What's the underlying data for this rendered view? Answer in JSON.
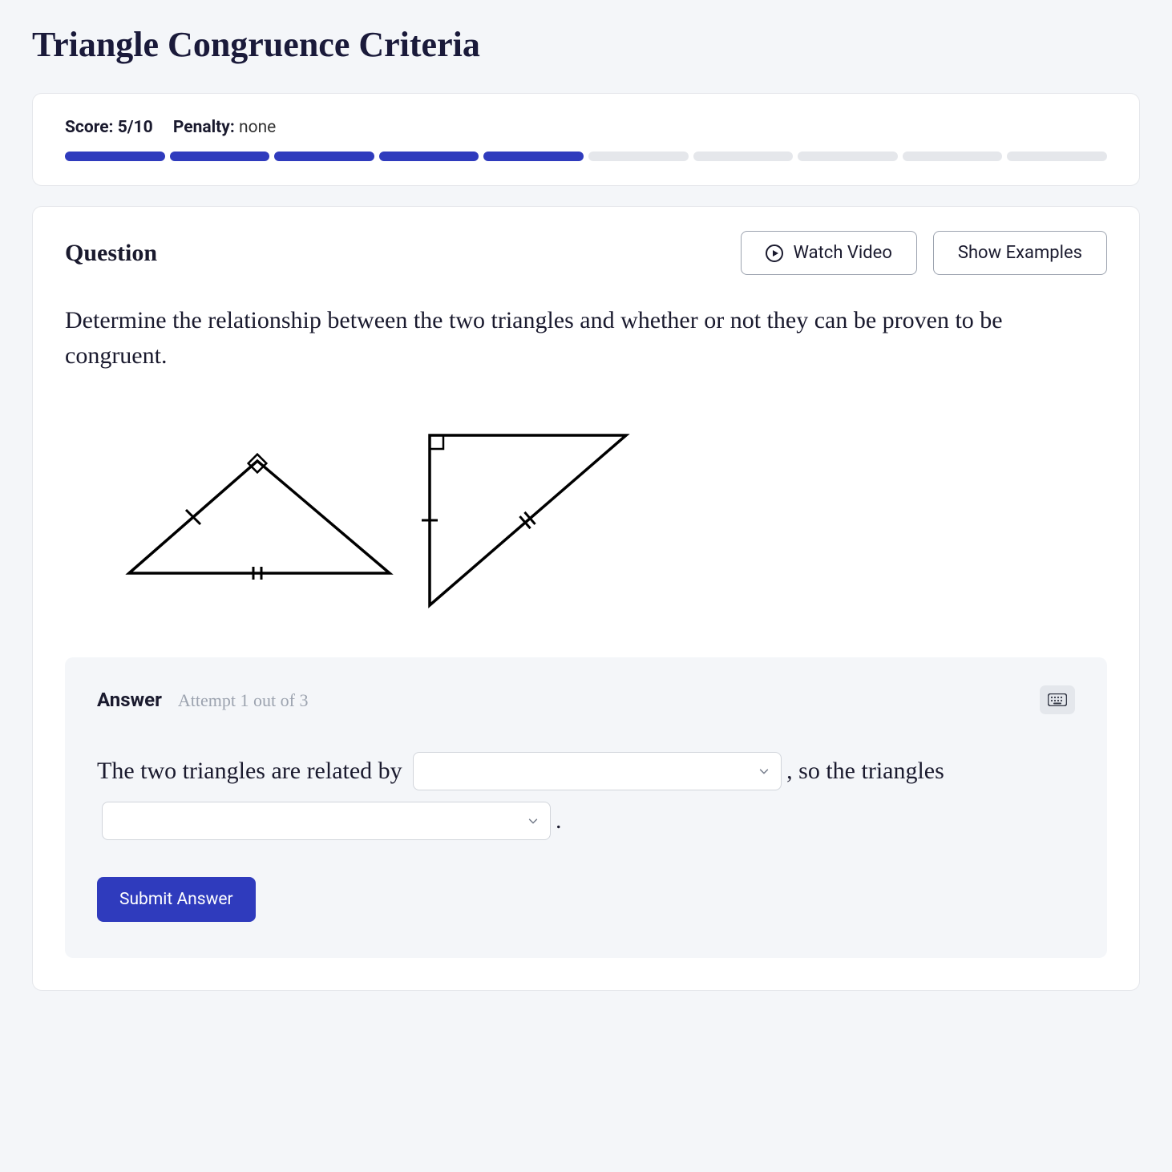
{
  "title": "Triangle Congruence Criteria",
  "score": {
    "label": "Score:",
    "value": "5/10"
  },
  "penalty": {
    "label": "Penalty:",
    "value": "none"
  },
  "progress": {
    "completed": 5,
    "total": 10
  },
  "question": {
    "heading": "Question",
    "watch_video_label": "Watch Video",
    "show_examples_label": "Show Examples",
    "prompt": "Determine the relationship between the two triangles and whether or not they can be proven to be congruent."
  },
  "answer": {
    "heading": "Answer",
    "attempt_text": "Attempt 1 out of 3",
    "sentence_part1": "The two triangles are related by ",
    "sentence_part2": ", so the triangles ",
    "sentence_part3": ".",
    "dropdown1_value": "",
    "dropdown2_value": "",
    "submit_label": "Submit Answer"
  },
  "colors": {
    "accent": "#2f3bbd"
  }
}
